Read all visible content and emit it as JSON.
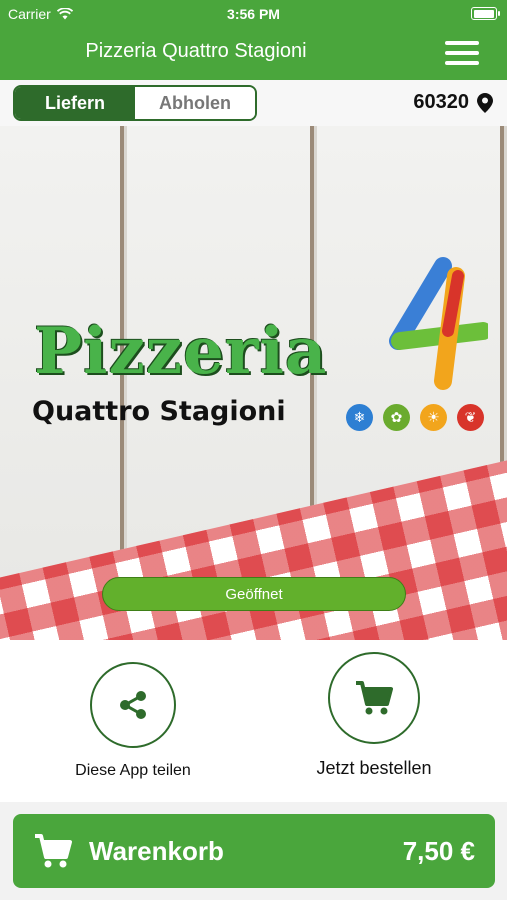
{
  "status_bar": {
    "carrier": "Carrier",
    "time": "3:56 PM"
  },
  "nav": {
    "title": "Pizzeria Quattro Stagioni",
    "menu_icon": "hamburger-menu-icon"
  },
  "delivery_toggle": {
    "options": [
      "Liefern",
      "Abholen"
    ],
    "selected": "Liefern"
  },
  "location": {
    "postcode": "60320",
    "icon": "map-pin-icon"
  },
  "hero": {
    "logo_line1": "Pizzeria",
    "logo_line2": "Quattro Stagioni",
    "status_label": "Geöffnet"
  },
  "actions": {
    "share_label": "Diese App teilen",
    "order_label": "Jetzt bestellen"
  },
  "cart": {
    "label": "Warenkorb",
    "total": "7,50 €"
  },
  "colors": {
    "primary": "#4aa63c",
    "dark_green": "#2e6b2b",
    "open_green": "#62b02c"
  }
}
